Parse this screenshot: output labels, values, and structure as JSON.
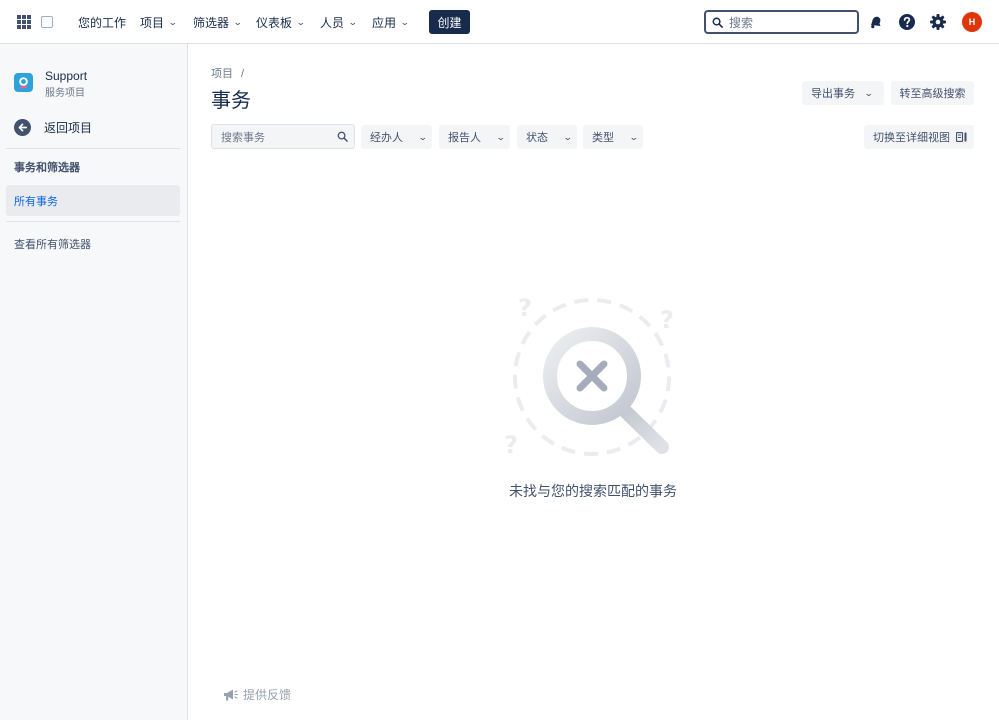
{
  "topnav": {
    "items": [
      {
        "label": "您的工作"
      },
      {
        "label": "项目"
      },
      {
        "label": "筛选器"
      },
      {
        "label": "仪表板"
      },
      {
        "label": "人员"
      },
      {
        "label": "应用"
      }
    ],
    "create_label": "创建",
    "search_placeholder": "搜索",
    "avatar_initial": "H"
  },
  "sidebar": {
    "project_name": "Support",
    "project_type": "服务项目",
    "back_label": "返回项目",
    "section_heading": "事务和筛选器",
    "active_item": "所有事务",
    "view_all_filters": "查看所有筛选器",
    "feedback_label": "提供反馈"
  },
  "main": {
    "breadcrumb": "项目",
    "breadcrumb_sep": "/",
    "title": "事务",
    "export_label": "导出事务",
    "advanced_search_label": "转至高级搜索",
    "issue_search_placeholder": "搜索事务",
    "filters": [
      {
        "label": "经办人"
      },
      {
        "label": "报告人"
      },
      {
        "label": "状态"
      },
      {
        "label": "类型"
      }
    ],
    "detail_view_label": "切换至详细视图",
    "empty_message": "未找与您的搜索匹配的事务"
  }
}
